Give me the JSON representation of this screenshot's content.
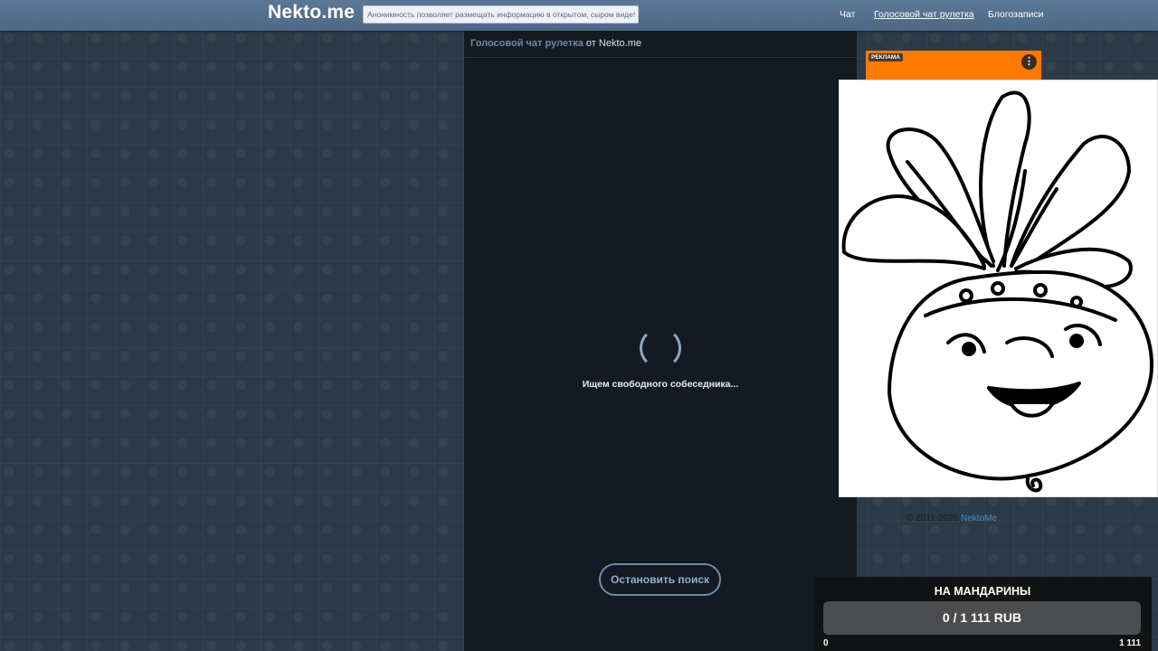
{
  "header": {
    "logo": "Nekto.me",
    "slogan": "Анонимность позволяет размещать информацию в открытом, сыром виде!",
    "nav": [
      "Чат",
      "Голосовой чат рулетка",
      "Блогозаписи"
    ]
  },
  "chat": {
    "title_link": "Голосовой чат рулетка",
    "title_suffix": " от Nekto.me",
    "status": "Ищем свободного собеседника...",
    "stop_button": "Остановить поиск"
  },
  "ad": {
    "label": "РЕКЛАМА",
    "menu_icon": "⋮"
  },
  "footer": {
    "copyright_prefix": "© 2011-2025 ",
    "copyright_brand": "NektoMe"
  },
  "donation": {
    "title": "НА МАНДАРИНЫ",
    "amount": "0 / 1 111 RUB",
    "min": "0",
    "max": "1 111",
    "progress": 0
  }
}
